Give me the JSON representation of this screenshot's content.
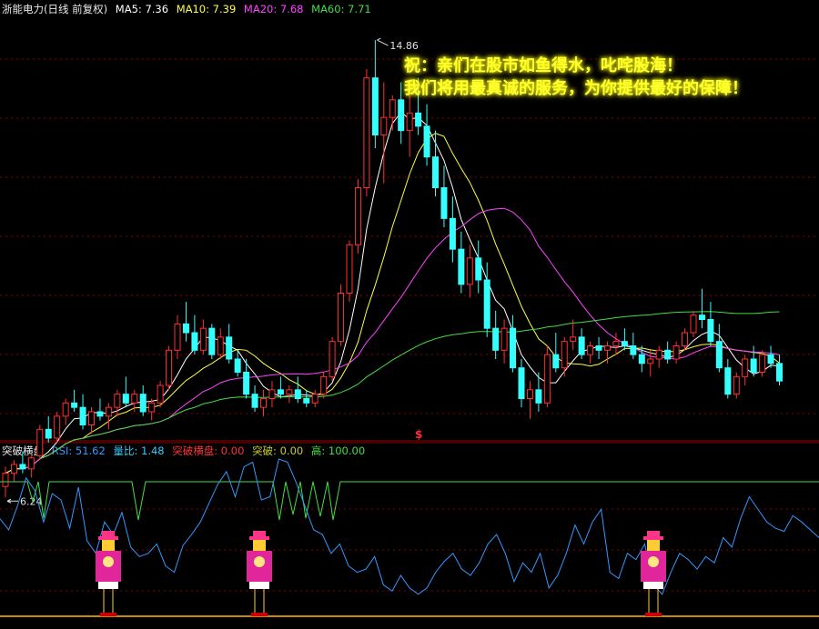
{
  "header": {
    "title": "浙能电力(日线 前复权)",
    "ma5": {
      "label": "MA5:",
      "value": "7.36",
      "color": "#ffffff"
    },
    "ma10": {
      "label": "MA10:",
      "value": "7.39",
      "color": "#ffff44"
    },
    "ma20": {
      "label": "MA20:",
      "value": "7.68",
      "color": "#ff44ff"
    },
    "ma60": {
      "label": "MA60:",
      "value": "7.71",
      "color": "#44dd44"
    }
  },
  "banner": {
    "line1": "祝：亲们在股市如鱼得水，叱咤股海！",
    "line2": "我们将用最真诚的服务，为你提供最好的保障！"
  },
  "indicator_header": {
    "name": "突破横盘",
    "rsi": {
      "label": "RSI:",
      "value": "51.62",
      "color": "#3399ff"
    },
    "vol_ratio": {
      "label": "量比:",
      "value": "1.48",
      "color": "#33ccff"
    },
    "breakout_flat": {
      "label": "突破横盘:",
      "value": "0.00",
      "color": "#ff3333"
    },
    "breakout": {
      "label": "突破:",
      "value": "0.00",
      "color": "#cccc33"
    },
    "high": {
      "label": "高:",
      "value": "100.00",
      "color": "#44dd44"
    }
  },
  "colors": {
    "up": "#ff3030",
    "down": "#33ffff",
    "grid": "#8b0000",
    "sep": "#8b0000"
  },
  "chart_data": [
    {
      "type": "candlestick",
      "name": "price",
      "annotations": {
        "high_label": "14.86",
        "low_label": "6.24",
        "marker": "$"
      },
      "ylim": [
        5.8,
        15.4
      ],
      "candles": [
        [
          4.7,
          5.15,
          4.45,
          5.0
        ],
        [
          5.0,
          5.3,
          4.8,
          5.2
        ],
        [
          5.2,
          5.5,
          5.0,
          5.1
        ],
        [
          5.1,
          5.4,
          4.9,
          5.35
        ],
        [
          5.4,
          6.1,
          5.3,
          6.0
        ],
        [
          6.0,
          6.3,
          5.7,
          5.8
        ],
        [
          5.8,
          6.4,
          5.7,
          6.3
        ],
        [
          6.3,
          6.7,
          6.1,
          6.6
        ],
        [
          6.6,
          6.9,
          6.4,
          6.5
        ],
        [
          6.5,
          6.8,
          6.0,
          6.1
        ],
        [
          6.1,
          6.5,
          5.9,
          6.4
        ],
        [
          6.4,
          6.7,
          6.2,
          6.3
        ],
        [
          6.3,
          6.6,
          6.0,
          6.5
        ],
        [
          6.5,
          6.9,
          6.3,
          6.8
        ],
        [
          6.8,
          7.2,
          6.5,
          6.6
        ],
        [
          6.6,
          6.9,
          6.4,
          6.8
        ],
        [
          6.8,
          7.0,
          6.3,
          6.4
        ],
        [
          6.4,
          6.7,
          6.2,
          6.6
        ],
        [
          6.6,
          7.1,
          6.5,
          7.0
        ],
        [
          7.0,
          7.9,
          6.9,
          7.8
        ],
        [
          7.8,
          8.6,
          7.6,
          8.4
        ],
        [
          8.4,
          8.9,
          8.0,
          8.2
        ],
        [
          8.2,
          8.6,
          7.7,
          7.8
        ],
        [
          7.8,
          8.5,
          7.7,
          8.3
        ],
        [
          8.3,
          8.4,
          7.6,
          7.7
        ],
        [
          7.7,
          8.3,
          7.6,
          8.1
        ],
        [
          8.1,
          8.4,
          7.5,
          7.6
        ],
        [
          7.6,
          7.8,
          7.2,
          7.3
        ],
        [
          7.3,
          7.6,
          6.7,
          6.8
        ],
        [
          6.8,
          7.0,
          6.4,
          6.5
        ],
        [
          6.5,
          6.9,
          6.3,
          6.7
        ],
        [
          6.7,
          7.1,
          6.5,
          6.9
        ],
        [
          6.9,
          7.2,
          6.7,
          6.8
        ],
        [
          6.8,
          7.0,
          6.6,
          6.9
        ],
        [
          6.9,
          7.2,
          6.6,
          6.7
        ],
        [
          6.7,
          6.9,
          6.5,
          6.6
        ],
        [
          6.6,
          6.9,
          6.5,
          6.8
        ],
        [
          6.8,
          7.3,
          6.7,
          7.2
        ],
        [
          7.2,
          8.1,
          7.1,
          8.0
        ],
        [
          8.0,
          9.3,
          7.9,
          9.1
        ],
        [
          9.1,
          10.3,
          8.9,
          10.2
        ],
        [
          10.2,
          11.7,
          10.0,
          11.5
        ],
        [
          11.5,
          14.2,
          11.3,
          14.0
        ],
        [
          14.0,
          14.86,
          12.4,
          12.7
        ],
        [
          12.7,
          13.9,
          11.6,
          13.1
        ],
        [
          13.1,
          13.6,
          12.8,
          13.5
        ],
        [
          13.5,
          13.9,
          12.5,
          12.8
        ],
        [
          12.8,
          13.6,
          12.2,
          13.2
        ],
        [
          13.2,
          14.0,
          12.7,
          12.9
        ],
        [
          12.9,
          13.4,
          12.0,
          12.2
        ],
        [
          12.2,
          12.8,
          11.3,
          11.5
        ],
        [
          11.5,
          12.0,
          10.6,
          10.8
        ],
        [
          10.8,
          11.3,
          9.8,
          10.1
        ],
        [
          10.1,
          10.5,
          9.1,
          9.3
        ],
        [
          9.3,
          10.2,
          9.0,
          9.9
        ],
        [
          9.9,
          10.3,
          9.1,
          9.4
        ],
        [
          9.4,
          9.8,
          8.1,
          8.3
        ],
        [
          8.3,
          8.7,
          7.6,
          7.8
        ],
        [
          7.8,
          8.5,
          7.5,
          8.3
        ],
        [
          8.3,
          8.6,
          7.3,
          7.4
        ],
        [
          7.4,
          7.6,
          6.5,
          6.7
        ],
        [
          6.7,
          7.1,
          6.24,
          6.9
        ],
        [
          6.9,
          7.3,
          6.4,
          6.6
        ],
        [
          6.6,
          7.9,
          6.5,
          7.7
        ],
        [
          7.7,
          8.2,
          7.3,
          7.4
        ],
        [
          7.4,
          8.1,
          7.2,
          8.0
        ],
        [
          8.0,
          8.5,
          7.8,
          8.1
        ],
        [
          8.1,
          8.3,
          7.6,
          7.7
        ],
        [
          7.7,
          8.0,
          7.5,
          7.9
        ],
        [
          7.9,
          8.1,
          7.6,
          7.8
        ],
        [
          7.8,
          8.0,
          7.5,
          7.9
        ],
        [
          7.9,
          8.2,
          7.7,
          8.0
        ],
        [
          8.0,
          8.3,
          7.8,
          7.9
        ],
        [
          7.9,
          8.2,
          7.6,
          7.7
        ],
        [
          7.7,
          7.9,
          7.3,
          7.5
        ],
        [
          7.5,
          7.8,
          7.2,
          7.6
        ],
        [
          7.6,
          7.9,
          7.4,
          7.8
        ],
        [
          7.8,
          8.0,
          7.5,
          7.6
        ],
        [
          7.6,
          8.0,
          7.5,
          7.9
        ],
        [
          7.9,
          8.3,
          7.8,
          8.2
        ],
        [
          8.2,
          8.7,
          8.1,
          8.6
        ],
        [
          8.6,
          9.2,
          8.3,
          8.5
        ],
        [
          8.5,
          8.9,
          7.9,
          8.0
        ],
        [
          8.0,
          8.4,
          7.3,
          7.4
        ],
        [
          7.4,
          7.6,
          6.7,
          6.8
        ],
        [
          6.8,
          7.3,
          6.7,
          7.2
        ],
        [
          7.2,
          7.7,
          7.0,
          7.6
        ],
        [
          7.6,
          7.9,
          7.2,
          7.3
        ],
        [
          7.3,
          7.8,
          7.2,
          7.7
        ],
        [
          7.7,
          7.9,
          7.4,
          7.5
        ],
        [
          7.5,
          7.7,
          7.0,
          7.1
        ]
      ]
    },
    {
      "type": "line",
      "name": "突破横盘",
      "ylim": [
        0,
        100
      ],
      "rsi": [
        62,
        55,
        70,
        88,
        80,
        60,
        78,
        74,
        56,
        82,
        48,
        40,
        60,
        52,
        66,
        44,
        38,
        40,
        46,
        32,
        28,
        45,
        52,
        60,
        72,
        84,
        92,
        76,
        95,
        98,
        74,
        76,
        100,
        98,
        85,
        70,
        55,
        52,
        40,
        46,
        32,
        28,
        30,
        38,
        20,
        16,
        26,
        18,
        14,
        18,
        28,
        35,
        40,
        30,
        26,
        34,
        46,
        52,
        40,
        22,
        34,
        28,
        40,
        18,
        26,
        40,
        58,
        46,
        60,
        68,
        28,
        24,
        40,
        36,
        46,
        20,
        14,
        28,
        40,
        36,
        30,
        38,
        34,
        50,
        44,
        62,
        76,
        68,
        60,
        56,
        54,
        64,
        60,
        55,
        50
      ]
    }
  ]
}
